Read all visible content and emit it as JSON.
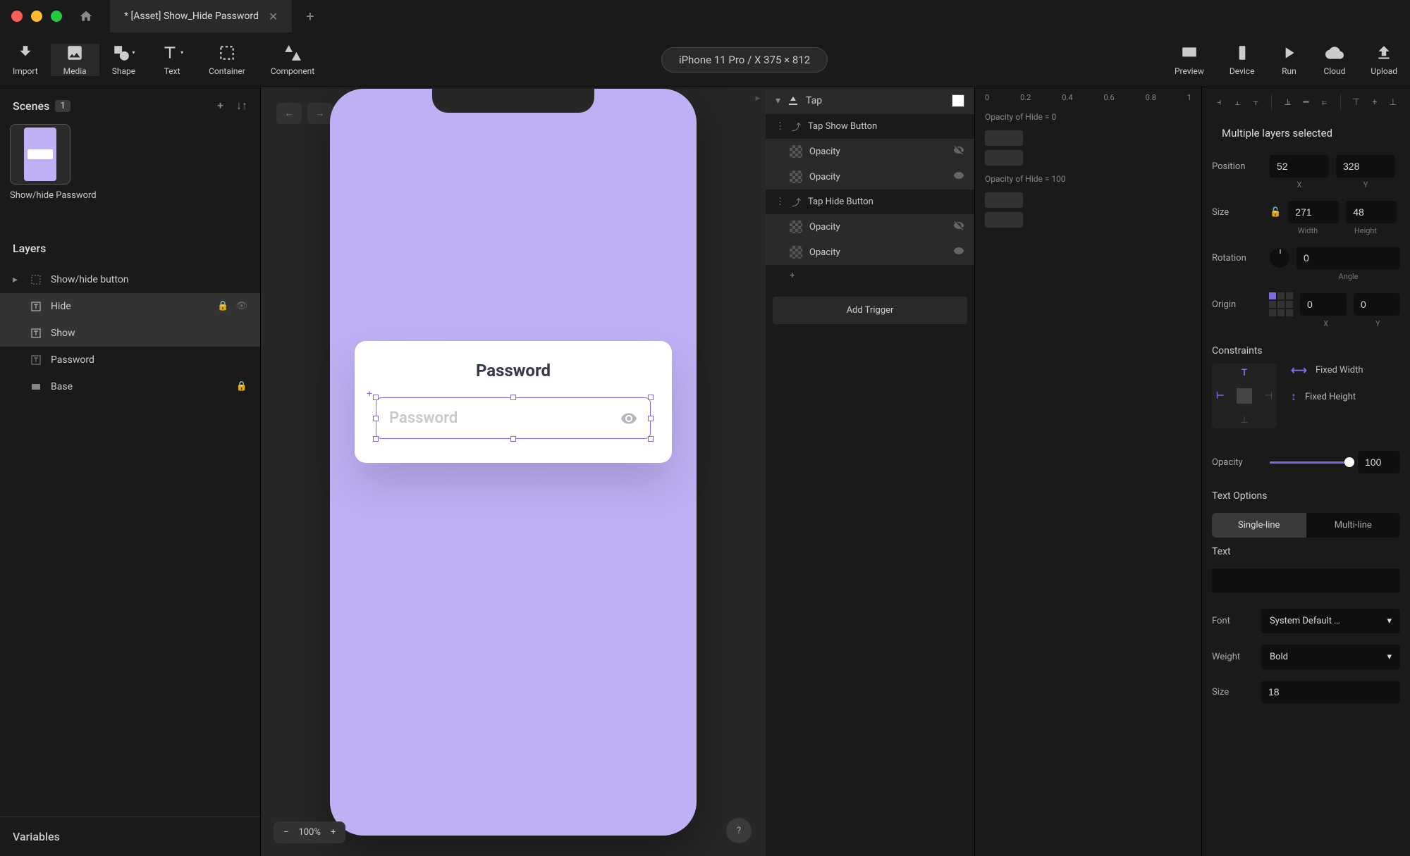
{
  "titlebar": {
    "tab_title": "* [Asset] Show_Hide Password"
  },
  "toolbar": {
    "import": "Import",
    "media": "Media",
    "shape": "Shape",
    "text": "Text",
    "container": "Container",
    "component": "Component",
    "device_label": "iPhone 11 Pro / X  375 × 812",
    "preview": "Preview",
    "device": "Device",
    "run": "Run",
    "cloud": "Cloud",
    "upload": "Upload"
  },
  "scenes": {
    "header": "Scenes",
    "count": "1",
    "items": [
      {
        "label": "Show/hide Password"
      }
    ]
  },
  "layers": {
    "header": "Layers",
    "items": [
      {
        "label": "Show/hide button"
      },
      {
        "label": "Hide"
      },
      {
        "label": "Show"
      },
      {
        "label": "Password"
      },
      {
        "label": "Base"
      }
    ]
  },
  "variables": {
    "header": "Variables"
  },
  "canvas": {
    "card_title": "Password",
    "placeholder": "Password",
    "zoom": "100%"
  },
  "triggers": {
    "tap": "Tap",
    "tap_show": "Tap Show Button",
    "tap_hide": "Tap Hide Button",
    "opacity": "Opacity",
    "add_trigger": "Add Trigger"
  },
  "timeline": {
    "ticks": [
      "0",
      "0.2",
      "0.4",
      "0.6",
      "0.8",
      "1"
    ],
    "caption1": "Opacity of Hide = 0",
    "caption2": "Opacity of Hide = 100"
  },
  "inspector": {
    "title": "Multiple layers selected",
    "position_label": "Position",
    "pos_x": "52",
    "pos_y": "328",
    "x_label": "X",
    "y_label": "Y",
    "size_label": "Size",
    "width": "271",
    "height": "48",
    "width_label": "Width",
    "height_label": "Height",
    "rotation_label": "Rotation",
    "rotation": "0",
    "angle_label": "Angle",
    "origin_label": "Origin",
    "origin_x": "0",
    "origin_y": "0",
    "constraints_label": "Constraints",
    "fixed_width": "Fixed Width",
    "fixed_height": "Fixed Height",
    "opacity_label": "Opacity",
    "opacity": "100",
    "text_options": "Text Options",
    "single_line": "Single-line",
    "multi_line": "Multi-line",
    "text_label": "Text",
    "font_label": "Font",
    "font_value": "System Default …",
    "weight_label": "Weight",
    "weight_value": "Bold",
    "size2_label": "Size",
    "size2_value": "18"
  }
}
